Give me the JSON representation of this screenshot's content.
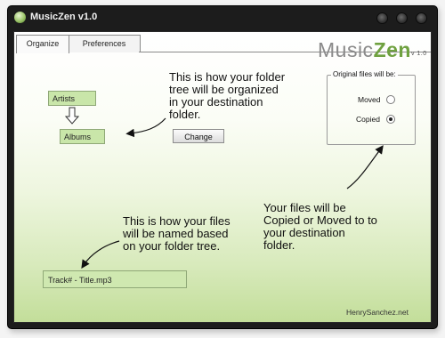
{
  "window": {
    "title": "MusicZen v1.0"
  },
  "tabs": [
    {
      "label": "Organize"
    },
    {
      "label": "Preferences"
    }
  ],
  "logo": {
    "music": "Music",
    "zen": "Zen",
    "version": "v 1.0"
  },
  "organize": {
    "folder_callout": [
      "This is how your folder",
      "tree will be organized",
      "in your destination",
      "folder."
    ],
    "tree": {
      "level1": "Artists",
      "level2": "Albums"
    },
    "change_button": "Change",
    "files_callout": [
      "This is how your files",
      "will be named based",
      "on your folder tree."
    ],
    "filename_pattern": "Track# - Title.mp3",
    "copy_callout": [
      "Your files will be",
      "Copied or Moved to to",
      "your destination",
      "folder."
    ],
    "original_files": {
      "legend": "Original files will be:",
      "options": [
        {
          "label": "Moved",
          "selected": false
        },
        {
          "label": "Copied",
          "selected": true
        }
      ]
    }
  },
  "footer": {
    "credit": "HenrySanchez.net"
  }
}
